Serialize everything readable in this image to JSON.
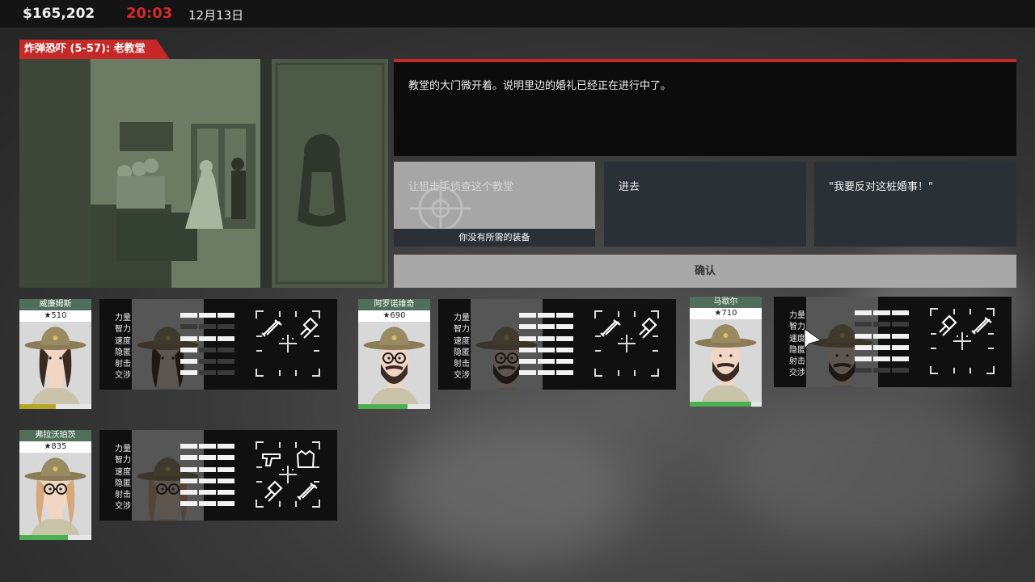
{
  "hud": {
    "money": "$165,202",
    "time": "20:03",
    "date": "12月13日"
  },
  "mission": {
    "title": "炸弹恐吓 (5-57): 老教堂",
    "description": "教堂的大门微开着。说明里边的婚礼已经正在进行中了。"
  },
  "choices": [
    {
      "label": "让狙击手侦查这个教堂",
      "note": "你没有所需的装备",
      "enabled": false
    },
    {
      "label": "进去",
      "enabled": true
    },
    {
      "label": "\"我要反对这桩婚事！\"",
      "enabled": true
    }
  ],
  "confirm_label": "确认",
  "stat_names": [
    "力量",
    "智力",
    "速度",
    "隐匿",
    "射击",
    "交涉"
  ],
  "agents": [
    {
      "name": "威廉姆斯",
      "rating": "★510",
      "hp": 0.5,
      "hp_color": "#b4a627",
      "stats": [
        3,
        0,
        3,
        1,
        1,
        1
      ],
      "equipment": [
        "sniper-rifle-icon",
        "flashlight-icon"
      ],
      "face": "woman"
    },
    {
      "name": "阿罗诺维奇",
      "rating": "★690",
      "hp": 0.68,
      "hp_color": "#4caf50",
      "stats": [
        3,
        3,
        3,
        3,
        3,
        3
      ],
      "equipment": [
        "sniper-rifle-icon",
        "flashlight-icon"
      ],
      "face": "beard-glasses"
    },
    {
      "name": "马歇尔",
      "rating": "★710",
      "hp": 0.85,
      "hp_color": "#4caf50",
      "stats": [
        3,
        0,
        3,
        3,
        3,
        0
      ],
      "equipment": [
        "flashlight-icon",
        "sniper-rifle-icon"
      ],
      "face": "beard"
    },
    {
      "name": "弗拉沃珀茨",
      "rating": "★835",
      "hp": 0.67,
      "hp_color": "#4caf50",
      "stats": [
        3,
        3,
        3,
        3,
        3,
        3
      ],
      "equipment": [
        "pistol-icon",
        "vest-icon",
        "flashlight-icon",
        "sniper-rifle-icon"
      ],
      "face": "round-glasses"
    }
  ]
}
